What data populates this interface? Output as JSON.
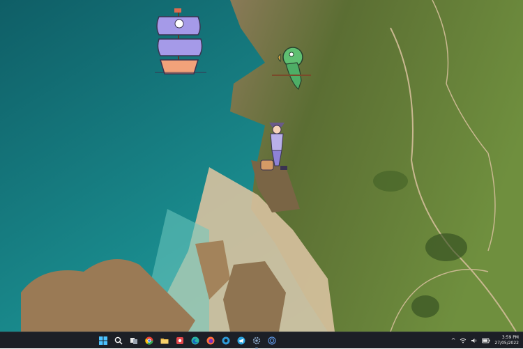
{
  "desktop": {
    "wallpaper": "aerial-coastline-beach",
    "stickers": [
      {
        "name": "pirate-ship-sticker",
        "icon": "pirate-ship-icon"
      },
      {
        "name": "parrot-sticker",
        "icon": "parrot-icon"
      },
      {
        "name": "pirate-girl-sticker",
        "icon": "pirate-girl-icon"
      }
    ]
  },
  "taskbar": {
    "icons": [
      {
        "name": "start-button",
        "icon": "windows-icon",
        "color": "#4cc2ff"
      },
      {
        "name": "search-button",
        "icon": "search-icon",
        "color": "#ffffff"
      },
      {
        "name": "task-view-button",
        "icon": "task-view-icon",
        "color": "#ffffff"
      },
      {
        "name": "chrome-button",
        "icon": "chrome-icon",
        "color": "#2ea84b"
      },
      {
        "name": "file-explorer-button",
        "icon": "folder-icon",
        "color": "#f2c14e"
      },
      {
        "name": "app-button",
        "icon": "app-icon",
        "color": "#e2464a"
      },
      {
        "name": "edge-button",
        "icon": "edge-icon",
        "color": "#2bb5a4"
      },
      {
        "name": "firefox-button",
        "icon": "firefox-icon",
        "color": "#ff7139"
      },
      {
        "name": "edge-dev-button",
        "icon": "edge-dev-icon",
        "color": "#2d9ad7"
      },
      {
        "name": "telegram-button",
        "icon": "telegram-icon",
        "color": "#2aa3df"
      },
      {
        "name": "settings-button",
        "icon": "gear-icon",
        "color": "#8aa6c6"
      },
      {
        "name": "app-circle-button",
        "icon": "circle-app-icon",
        "color": "#5a8fd8"
      }
    ],
    "tray": {
      "chevron": "^",
      "clock_time": "3:59 PM",
      "clock_date": "27/05/2022"
    }
  }
}
